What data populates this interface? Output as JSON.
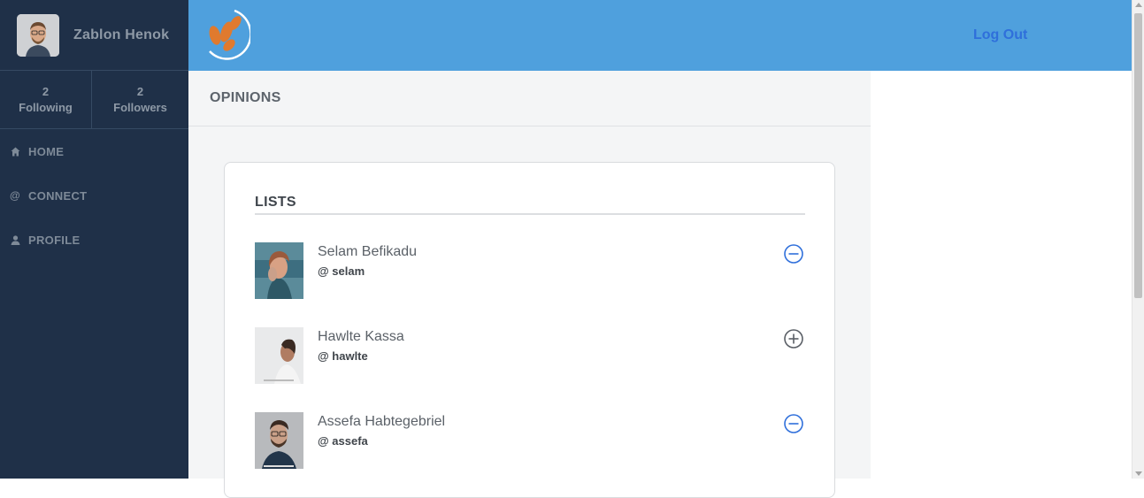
{
  "user": {
    "name": "Zablon Henok"
  },
  "stats": [
    {
      "count": "2",
      "label": "Following"
    },
    {
      "count": "2",
      "label": "Followers"
    }
  ],
  "nav": [
    {
      "icon": "home-icon",
      "label": "HOME"
    },
    {
      "icon": "at-icon",
      "label": "CONNECT"
    },
    {
      "icon": "person-icon",
      "label": "PROFILE"
    }
  ],
  "topbar": {
    "logout_label": "Log Out"
  },
  "main": {
    "section_title": "OPINIONS",
    "card_title": "LISTS"
  },
  "people": [
    {
      "name": "Selam Befikadu",
      "handle": "@ selam",
      "action": "minus-circle-icon"
    },
    {
      "name": "Hawlte Kassa",
      "handle": "@ hawlte",
      "action": "plus-circle-icon"
    },
    {
      "name": "Assefa Habtegebriel",
      "handle": "@ assefa",
      "action": "minus-circle-icon"
    }
  ],
  "colors": {
    "sidebar": "#1f3048",
    "topbar": "#4fa0dd",
    "accent": "#2f6fdb",
    "logo": "#e07a2e"
  }
}
